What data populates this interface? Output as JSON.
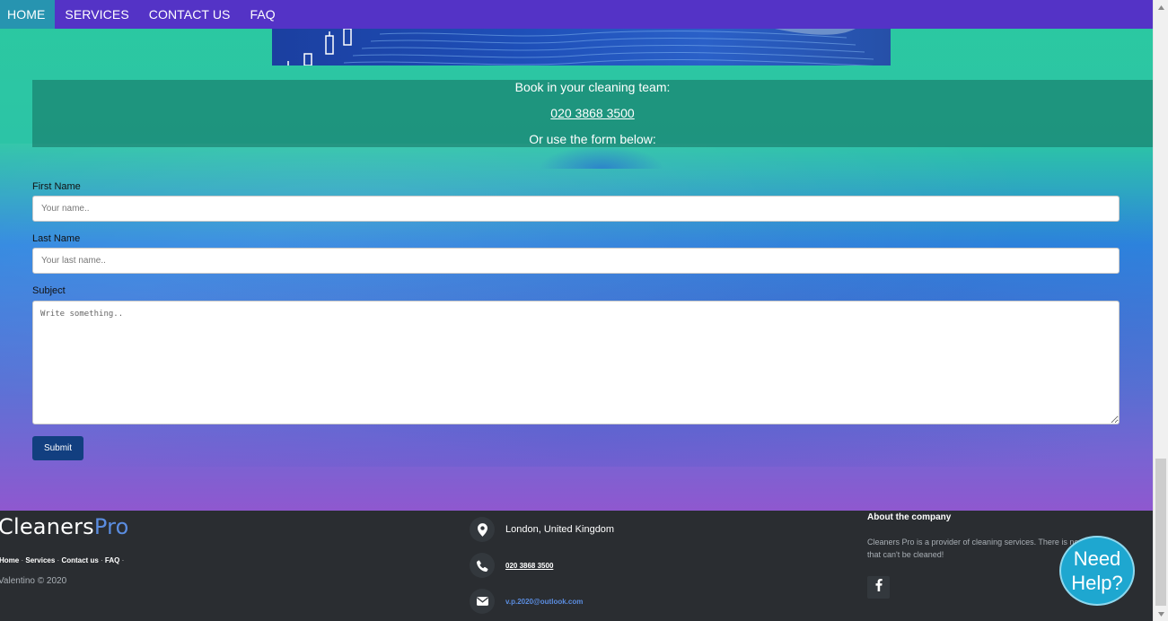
{
  "nav": {
    "items": [
      {
        "label": "HOME",
        "active": true
      },
      {
        "label": "SERVICES"
      },
      {
        "label": "CONTACT US"
      },
      {
        "label": "FAQ"
      }
    ]
  },
  "booking": {
    "line1": "Book in your cleaning team:",
    "phone": "020 3868 3500",
    "line3": "Or use the form below:"
  },
  "form": {
    "first_name_label": "First Name",
    "first_name_placeholder": "Your name..",
    "last_name_label": "Last Name",
    "last_name_placeholder": "Your last name..",
    "subject_label": "Subject",
    "subject_placeholder": "Write something..",
    "submit_label": "Submit"
  },
  "footer": {
    "brand_main": "Cleaners",
    "brand_accent": "Pro",
    "links": [
      "Home",
      "Services",
      "Contact us",
      "FAQ"
    ],
    "copyright": "Valentino © 2020",
    "contact": {
      "address": "London, United Kingdom",
      "phone": "020 3868 3500",
      "email": "v.p.2020@outlook.com"
    },
    "about_title": "About the company",
    "about_text": "Cleaners Pro is a provider of cleaning services. There is no mess that can't be cleaned!"
  },
  "help_widget": {
    "line1": "Need",
    "line2": "Help?"
  },
  "colors": {
    "navbar": "#5433c6",
    "nav_active": "#2794b0",
    "submit": "#123f80",
    "footer": "#2a2d31",
    "brand_accent": "#5b8de0",
    "help_widget": "#1ea7d0"
  },
  "icons": {
    "address": "map-marker-icon",
    "phone": "phone-icon",
    "email": "envelope-icon",
    "social": "facebook-icon"
  }
}
